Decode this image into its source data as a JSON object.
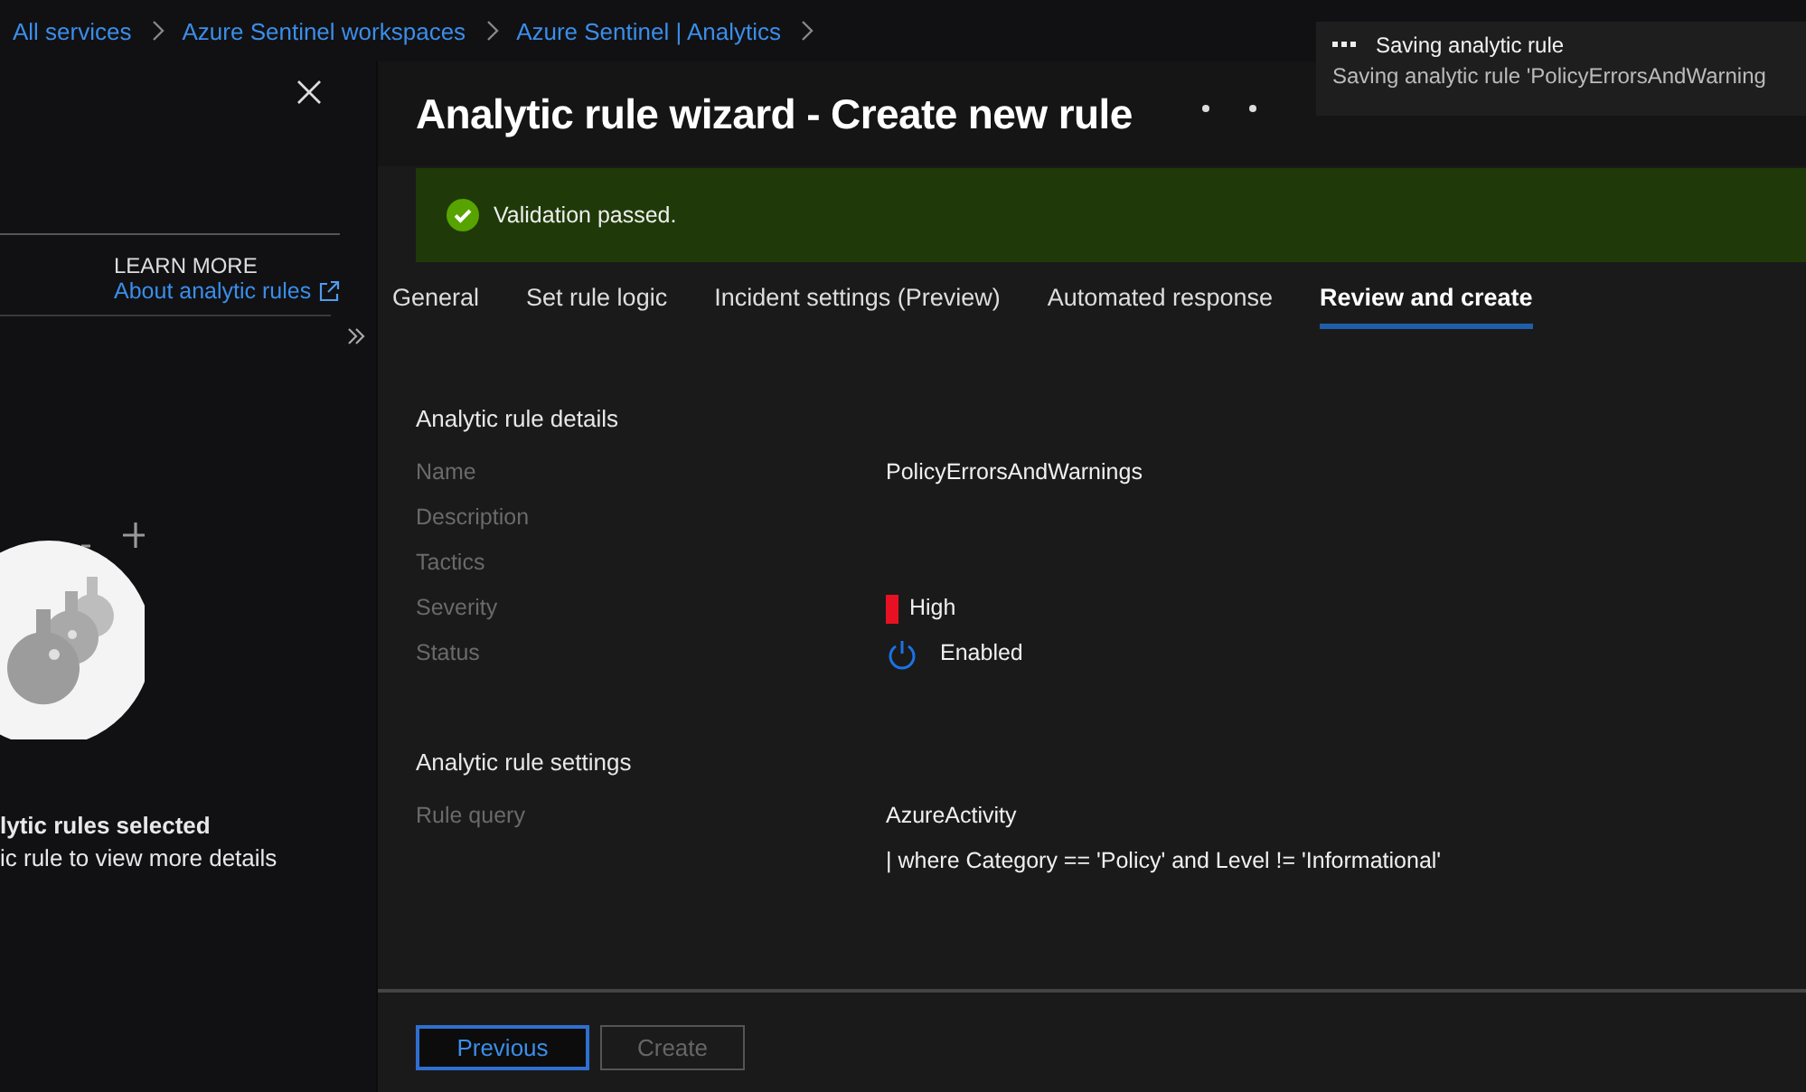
{
  "breadcrumbs": [
    "All services",
    "Azure Sentinel workspaces",
    "Azure Sentinel | Analytics"
  ],
  "side_panel": {
    "learn_more_heading": "LEARN MORE",
    "link": "About analytic rules",
    "empty_title": "lytic rules selected",
    "empty_subtitle": "ic rule to view more details"
  },
  "title": "Analytic rule wizard - Create new rule",
  "toast": {
    "title": "Saving analytic rule",
    "message": "Saving analytic rule 'PolicyErrorsAndWarning"
  },
  "banner": {
    "text": "Validation passed."
  },
  "tabs": [
    {
      "label": "General",
      "selected": false
    },
    {
      "label": "Set rule logic",
      "selected": false
    },
    {
      "label": "Incident settings (Preview)",
      "selected": false
    },
    {
      "label": "Automated response",
      "selected": false
    },
    {
      "label": "Review and create",
      "selected": true
    }
  ],
  "sections": [
    {
      "heading": "Analytic rule details",
      "rows": [
        {
          "kind": "text",
          "label": "Name",
          "lines": [
            "PolicyErrorsAndWarnings"
          ]
        },
        {
          "kind": "text",
          "label": "Description"
        },
        {
          "kind": "text",
          "label": "Tactics"
        },
        {
          "kind": "severity",
          "label": "Severity",
          "lines": [
            "High"
          ],
          "color": "#e81123"
        },
        {
          "kind": "status",
          "label": "Status",
          "lines": [
            "Enabled"
          ],
          "on": true
        }
      ]
    },
    {
      "heading": "Analytic rule settings",
      "rows": [
        {
          "kind": "text",
          "label": "Rule query",
          "lines": [
            "AzureActivity",
            "| where Category == 'Policy' and Level != 'Informational'"
          ]
        }
      ]
    }
  ],
  "buttons": [
    {
      "label": "Previous",
      "disabled": false
    },
    {
      "label": "Create",
      "disabled": true
    }
  ]
}
